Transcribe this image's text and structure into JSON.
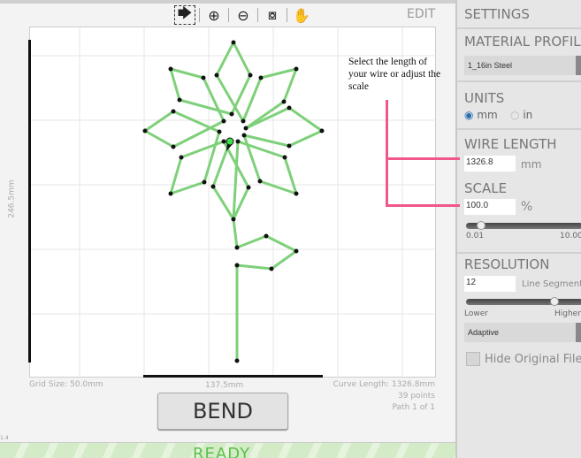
{
  "toolbar": {
    "tools": [
      "select-tool",
      "zoom-in",
      "zoom-out",
      "zoom-fit",
      "pan"
    ],
    "mode_label": "EDIT"
  },
  "canvas": {
    "height_label": "246.5mm",
    "width_label": "137.5mm",
    "grid_size": "Grid Size: 50.0mm",
    "curve_length": "Curve Length: 1326.8mm",
    "points": "39 points",
    "path": "Path 1 of 1",
    "wire_color": "#7fd07a"
  },
  "annotation": {
    "text": "Select the length of your wire or adjust the scale",
    "color": "#f0588a"
  },
  "bend_label": "BEND",
  "version": "1.4",
  "status": "READY",
  "settings": {
    "title": "SETTINGS",
    "material_profile": {
      "label": "MATERIAL PROFILE",
      "value": "1_16in Steel"
    },
    "units": {
      "label": "UNITS",
      "options": [
        "mm",
        "in"
      ],
      "selected": "mm"
    },
    "wire_length": {
      "label": "WIRE LENGTH",
      "value": "1326.8",
      "unit": "mm"
    },
    "scale": {
      "label": "SCALE",
      "value": "100.0",
      "unit": "%",
      "min_label": "0.01",
      "max_label": "10.00",
      "slider_fraction": 0.1
    },
    "resolution": {
      "label": "RESOLUTION",
      "value": "12",
      "unit": "Line Segments",
      "lower": "Lower",
      "higher": "Higher",
      "slider_fraction": 0.78,
      "mode": "Adaptive"
    },
    "hide_original": {
      "label": "Hide Original File",
      "checked": false
    }
  }
}
